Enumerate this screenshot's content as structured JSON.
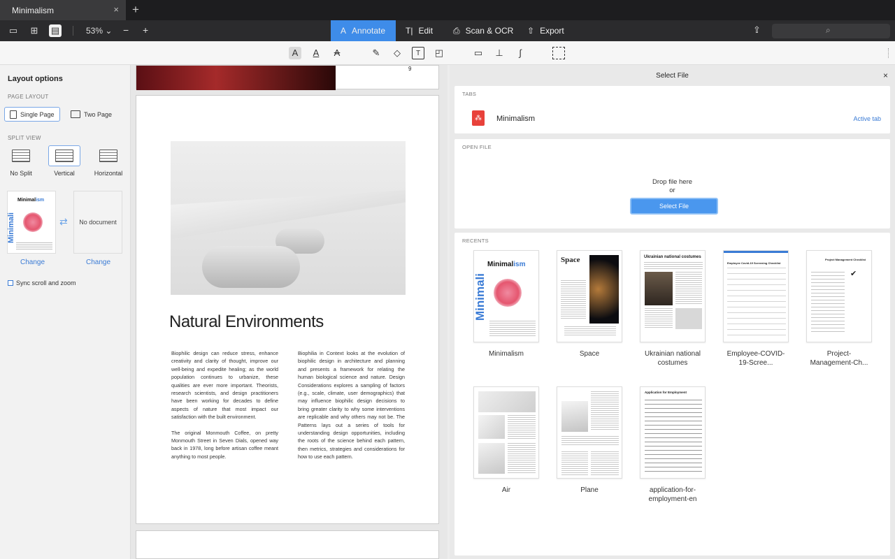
{
  "titlebar": {
    "tab_label": "Minimalism",
    "close_glyph": "×",
    "new_tab_glyph": "+"
  },
  "toolbar": {
    "zoom": "53%",
    "zoom_chevron": "⌄",
    "zoom_out": "−",
    "zoom_in": "+",
    "modes": [
      "Annotate",
      "Edit",
      "Scan & OCR",
      "Export"
    ],
    "mode_icons": [
      "A",
      "T|",
      "⎙",
      "⇧"
    ],
    "active_mode": "Annotate"
  },
  "annotate_tools": [
    "text-highlight-icon",
    "text-underline-icon",
    "text-strike-icon",
    "pen-icon",
    "eraser-icon",
    "text-box-icon",
    "shapes-icon",
    "comment-icon",
    "stamp-icon",
    "signature-icon",
    "selection-icon"
  ],
  "sidebar": {
    "title": "Layout options",
    "page_layout_label": "PAGE LAYOUT",
    "single_page": "Single Page",
    "two_page": "Two Page",
    "split_view_label": "SPLIT VIEW",
    "no_split": "No Split",
    "vertical": "Vertical",
    "horizontal": "Horizontal",
    "doc1_title_a": "Minimal",
    "doc1_title_b": "ism",
    "doc1_side": "Minimali",
    "no_document": "No document",
    "change": "Change",
    "sync": "Sync scroll and zoom"
  },
  "document": {
    "prev_page_number": "9  ",
    "title": "Natural Environments",
    "col1": [
      "Biophilic design can reduce stress, enhance creativity and clarity of thought, improve our well-being and expedite healing; as the world population continues to urbanize, these qualities are ever more important. Theorists, research scientists, and design practitioners have been working for decades to define aspects of nature that most impact our satisfaction with the built environment.",
      "The original Monmouth Coffee, on pretty Monmouth Street in Seven Dials, opened way back in 1978, long before artisan coffee meant anything to most people."
    ],
    "col2": [
      "Biophilia in Context looks at the evolution of biophilic design in architecture and planning and presents a framework for relating the human biological science and nature. Design Considerations explores a sampling of factors (e.g., scale, climate, user demographics) that may influence biophilic design decisions to bring greater clarity to why some interventions are replicable and why others may not be. The Patterns lays out a series of tools for understanding design opportunities, including the roots of the science behind each pattern, then metrics, strategies and considerations for how to use each pattern."
    ]
  },
  "panel": {
    "title": "Select File",
    "close": "×",
    "tabs_label": "TABS",
    "tab_name": "Minimalism",
    "active_tab": "Active tab",
    "open_file_label": "OPEN FILE",
    "drop": "Drop file here",
    "or": "or",
    "select_file": "Select File",
    "recents_label": "RECENTS",
    "thumb_minimal_a": "Minimal",
    "thumb_minimal_b": "ism",
    "thumb_minimal_side": "Minimali",
    "thumb_space_title": "Space",
    "thumb_ukr_title": "Ukrainian national costumes",
    "thumb_emp_title": "Employee Covid-19 Screening Checklist",
    "thumb_proj_title": "Project Management Checklist",
    "thumb_proj_check": "✔",
    "thumb_app_title": "Application for Employment",
    "recents": [
      {
        "label": "Minimalism"
      },
      {
        "label": "Space"
      },
      {
        "label": "Ukrainian national costumes"
      },
      {
        "label": "Employee-COVID-19-Scree..."
      },
      {
        "label": "Project-Management-Ch..."
      },
      {
        "label": "Air"
      },
      {
        "label": "Plane"
      },
      {
        "label": "application-for-employment-en"
      }
    ]
  },
  "colors": {
    "accent": "#3e8ce9",
    "link": "#3a7bd5",
    "pdf": "#e8413a"
  }
}
